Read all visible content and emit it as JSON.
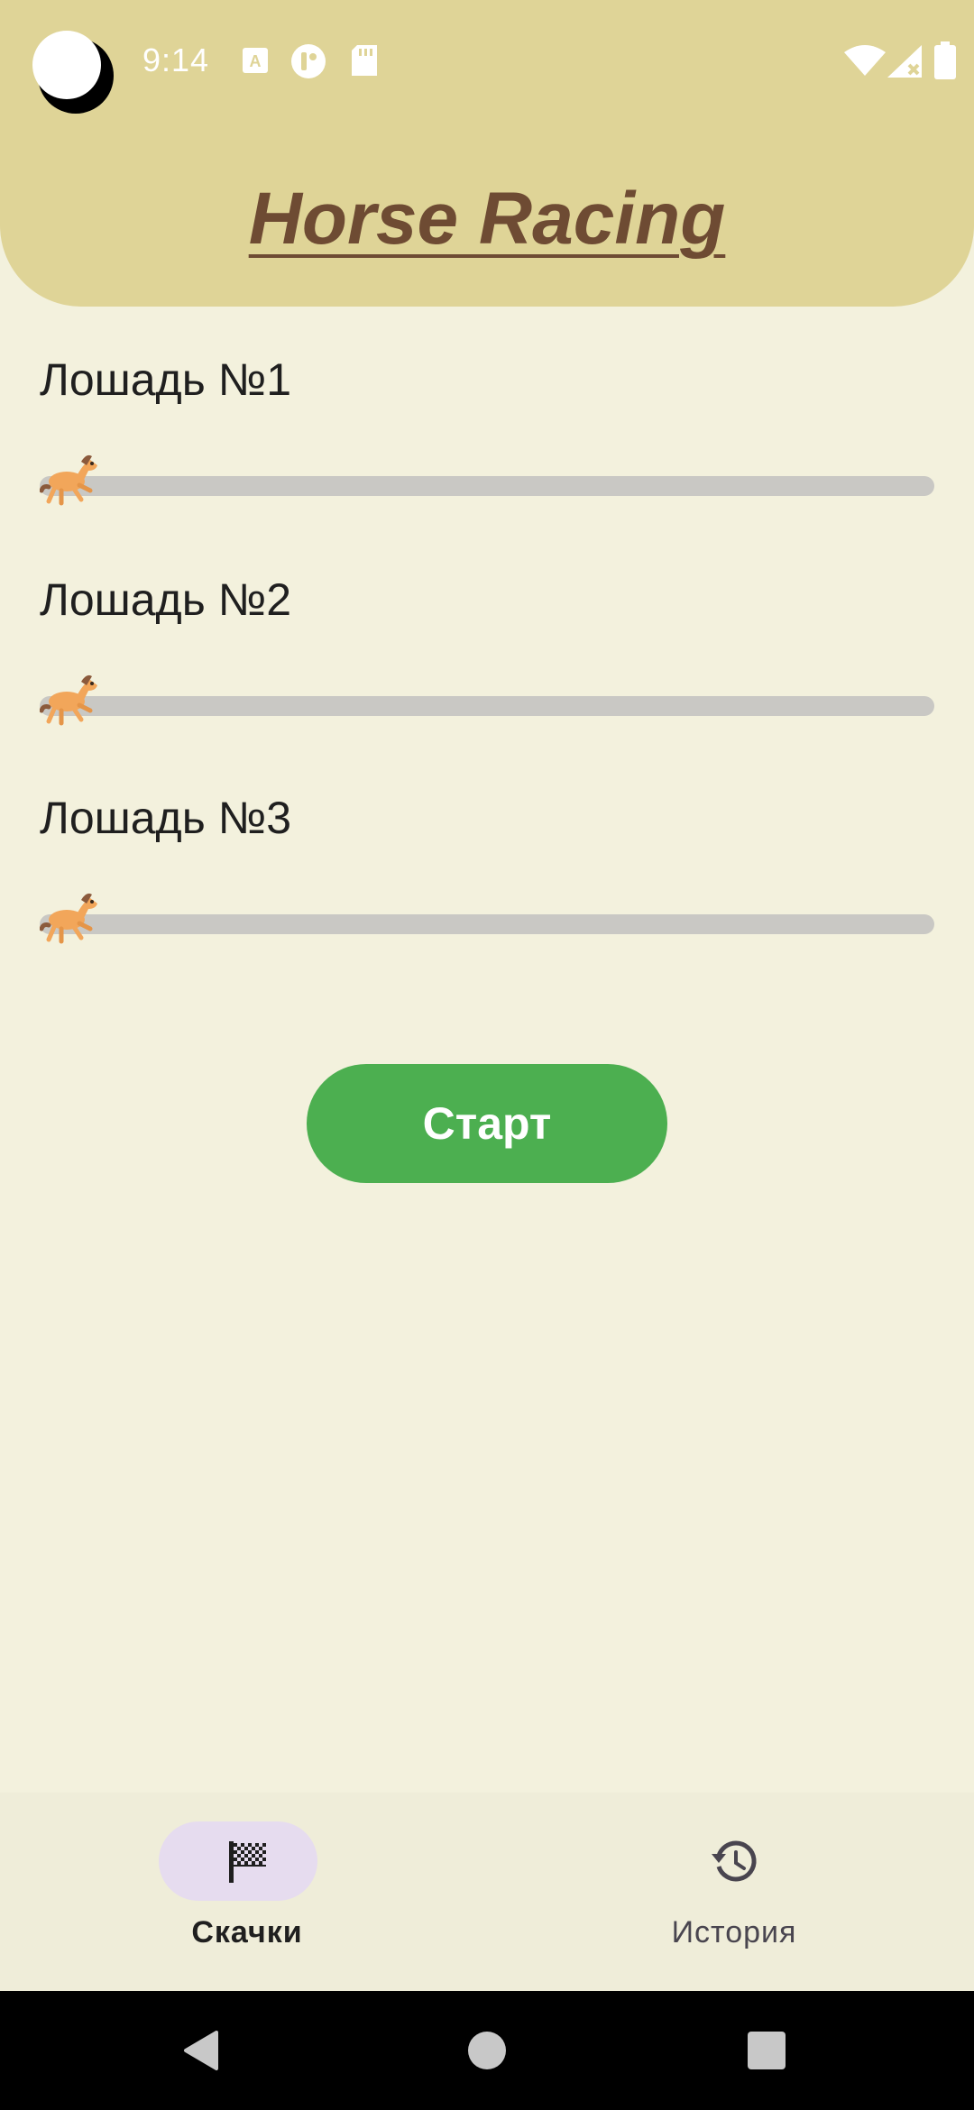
{
  "status_bar": {
    "time": "9:14",
    "left_icons": [
      "moon-icon",
      "keyboard-a-icon",
      "app-t-icon",
      "sd-card-icon"
    ],
    "right_icons": [
      "wifi-icon",
      "signal-no-sim-icon",
      "battery-icon"
    ]
  },
  "header": {
    "title": "Horse Racing"
  },
  "race": {
    "horses": [
      {
        "label": "Лошадь №1",
        "progress": 0.0
      },
      {
        "label": "Лошадь №2",
        "progress": 0.0
      },
      {
        "label": "Лошадь №3",
        "progress": 0.0
      }
    ],
    "horse_icon": "running-horse-icon"
  },
  "start_button": {
    "label": "Старт",
    "color": "#4caf50"
  },
  "bottom_nav": {
    "items": [
      {
        "label": "Скачки",
        "icon": "checkered-flag-icon",
        "selected": true
      },
      {
        "label": "История",
        "icon": "history-icon",
        "selected": false
      }
    ]
  },
  "system_nav": {
    "buttons": [
      "back-icon",
      "home-icon",
      "recents-icon"
    ]
  }
}
